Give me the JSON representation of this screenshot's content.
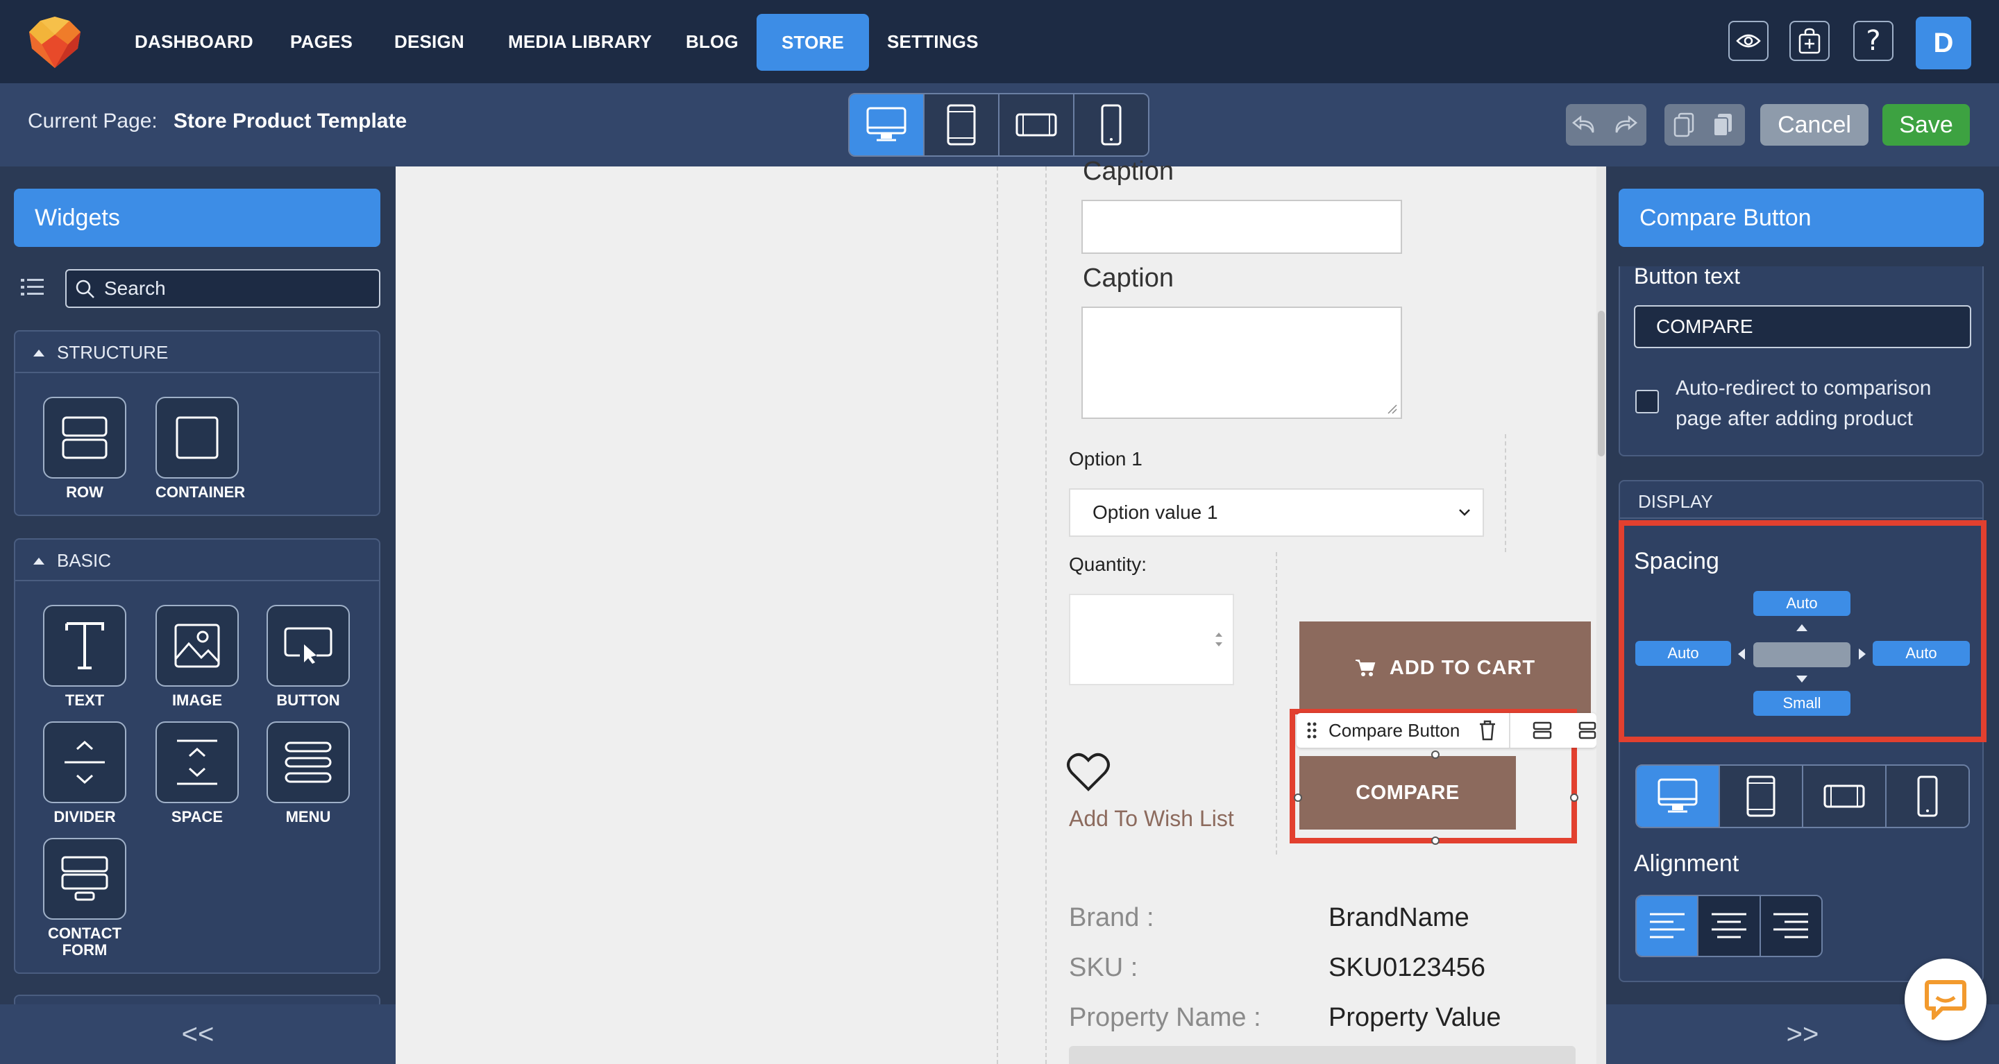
{
  "nav": {
    "items": [
      "DASHBOARD",
      "PAGES",
      "DESIGN",
      "MEDIA LIBRARY",
      "BLOG",
      "STORE",
      "SETTINGS"
    ],
    "active": "STORE",
    "avatar": "D"
  },
  "subheader": {
    "current_page_label": "Current Page:",
    "current_page_value": "Store Product Template",
    "cancel_label": "Cancel",
    "save_label": "Save"
  },
  "left_panel": {
    "title": "Widgets",
    "search_placeholder": "Search",
    "structure": {
      "title": "STRUCTURE",
      "widgets": [
        "ROW",
        "CONTAINER"
      ]
    },
    "basic": {
      "title": "BASIC",
      "widgets": [
        "TEXT",
        "IMAGE",
        "BUTTON",
        "DIVIDER",
        "SPACE",
        "MENU",
        "CONTACT FORM"
      ]
    },
    "collapse_label": "<<"
  },
  "canvas": {
    "caption_1": "Caption",
    "caption_2": "Caption",
    "option_label": "Option 1",
    "option_value": "Option value 1",
    "quantity_label": "Quantity:",
    "add_to_cart": "ADD TO CART",
    "wish_list": "Add To Wish List",
    "toolbar_label": "Compare Button",
    "compare": "COMPARE",
    "specs": [
      {
        "key": "Brand :",
        "value": "BrandName"
      },
      {
        "key": "SKU :",
        "value": "SKU0123456"
      },
      {
        "key": "Property Name :",
        "value": "Property Value"
      }
    ]
  },
  "right_panel": {
    "title": "Compare Button",
    "button_text_label": "Button text",
    "button_text_value": "COMPARE",
    "auto_redirect_label": "Auto-redirect to comparison page after adding product",
    "auto_redirect_checked": false,
    "display_title": "DISPLAY",
    "spacing_label": "Spacing",
    "spacing": {
      "top": "Auto",
      "left": "Auto",
      "right": "Auto",
      "bottom": "Small"
    },
    "alignment_label": "Alignment",
    "alignment_active": "left",
    "collapse_label": ">>"
  },
  "colors": {
    "accent": "#3d8de6",
    "save": "#3da241",
    "brown": "#8c6a5d",
    "highlight": "#e2402f"
  }
}
